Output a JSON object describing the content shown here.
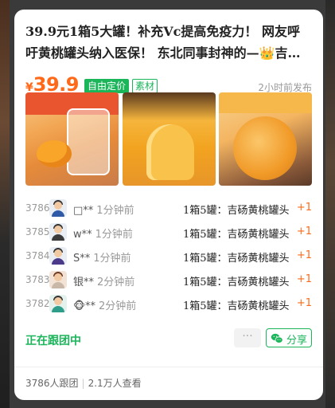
{
  "post": {
    "title": "39.9元1箱5大罐！补充Vc提高免疫力！ 网友呼吁黄桃罐头纳入医保！ 东北同事封神的—👑吉…",
    "price_symbol": "¥",
    "price_amount": "39.9",
    "tag_primary": "自由定价",
    "tag_secondary": "素材",
    "posted_time": "2小时前发布"
  },
  "images": [
    {
      "alt": "黄桃罐头产品图"
    },
    {
      "alt": "黄桃果肉特写"
    },
    {
      "alt": "黄桃罐头杯装"
    }
  ],
  "followers": [
    {
      "num": "3786",
      "name": "□**",
      "ago": "1分钟前",
      "item": "1箱5罐：吉砀黄桃罐头",
      "plus": "+1"
    },
    {
      "num": "3785",
      "name": "w**",
      "ago": "1分钟前",
      "item": "1箱5罐：吉砀黄桃罐头",
      "plus": "+1"
    },
    {
      "num": "3784",
      "name": "S**",
      "ago": "1分钟前",
      "item": "1箱5罐：吉砀黄桃罐头",
      "plus": "+1"
    },
    {
      "num": "3783",
      "name": "银**",
      "ago": "2分钟前",
      "item": "1箱5罐：吉砀黄桃罐头",
      "plus": "+1"
    },
    {
      "num": "3782",
      "name": "🐵**",
      "ago": "2分钟前",
      "item": "1箱5罐：吉砀黄桃罐头",
      "plus": "+1"
    }
  ],
  "actions": {
    "following_label": "正在跟团中",
    "more_label": "···",
    "share_label": "分享",
    "share_icon": "wechat-icon"
  },
  "stats": {
    "followers_count": "3786人跟团",
    "views_count": "2.1万人查看"
  },
  "colors": {
    "accent_green": "#1bb55a",
    "price_orange": "#ff6a1a"
  }
}
